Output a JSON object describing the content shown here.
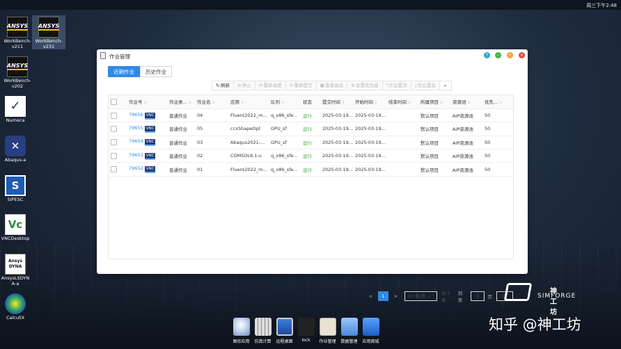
{
  "topbar": {
    "clock": "周三下午2:48"
  },
  "desktop_icons": [
    {
      "label_line1": "WorkBench-",
      "label_line2": "v211",
      "icon": "ansys-icon",
      "logo": "ANSYS"
    },
    {
      "label_line1": "WorkBench-",
      "label_line2": "v231",
      "icon": "ansys-icon",
      "logo": "ANSYS"
    },
    {
      "label_line1": "WorkBench-",
      "label_line2": "v202",
      "icon": "ansys-icon",
      "logo": "ANSYS"
    },
    {
      "label_line1": "Numeca",
      "label_line2": "",
      "icon": "numeca-icon"
    },
    {
      "label_line1": "Abaqus-a",
      "label_line2": "",
      "icon": "abaqus-icon"
    },
    {
      "label_line1": "SIPESC",
      "label_line2": "",
      "icon": "sipesc-icon"
    },
    {
      "label_line1": "VNCDesktop",
      "label_line2": "",
      "icon": "vnc-icon"
    },
    {
      "label_line1": "AnsysLSDYN",
      "label_line2": "A-a",
      "icon": "ls-dyna-icon",
      "logo_line1": "Ansys",
      "logo_line2": "DYNA"
    },
    {
      "label_line1": "CalculiX",
      "label_line2": "",
      "icon": "calculix-icon"
    }
  ],
  "window": {
    "title": "作业管理",
    "tabs": [
      {
        "label": "近期作业",
        "active": true
      },
      {
        "label": "历史作业",
        "active": false
      }
    ],
    "toolbar": [
      {
        "label": "刷新",
        "glyph": "↻",
        "enabled": true
      },
      {
        "label": "停止",
        "glyph": "⊘",
        "enabled": false
      },
      {
        "label": "重新调度",
        "glyph": "⟳",
        "enabled": false
      },
      {
        "label": "重新提交",
        "glyph": "⟳",
        "enabled": false
      },
      {
        "label": "查看输出",
        "glyph": "▣",
        "enabled": false
      },
      {
        "label": "设置优先级",
        "glyph": "⇅",
        "enabled": false
      },
      {
        "label": "作业置顶",
        "glyph": "⤒",
        "enabled": false
      },
      {
        "label": "作业置底",
        "glyph": "⤓",
        "enabled": false
      }
    ],
    "columns": [
      "作业号",
      "作业类...",
      "作业名",
      "应用",
      "队列",
      "状态",
      "提交时间",
      "开始时间",
      "结束时间",
      "所属项目",
      "资源池",
      "优先..."
    ],
    "rows": [
      {
        "id": "79656",
        "vnc": "VNC",
        "type": "普通作业",
        "name": "04",
        "app": "Fluent2022_m...",
        "queue": "q_x86_sfe...",
        "status": "运行",
        "submit": "2025-03-19...",
        "start": "2025-03-19...",
        "end": "",
        "project": "默认项目",
        "pool": "AIP资源池",
        "priority": "50"
      },
      {
        "id": "79655",
        "vnc": "VNC",
        "type": "普通作业",
        "name": "05",
        "app": "ccxShapeOpt",
        "queue": "GPU_sf",
        "status": "运行",
        "submit": "2025-03-19...",
        "start": "2025-03-19...",
        "end": "",
        "project": "默认项目",
        "pool": "AIP资源池",
        "priority": "50"
      },
      {
        "id": "79654",
        "vnc": "VNC",
        "type": "普通作业",
        "name": "03",
        "app": "Abaqus2021-...",
        "queue": "GPU_sf",
        "status": "运行",
        "submit": "2025-03-19...",
        "start": "2025-03-19...",
        "end": "",
        "project": "默认项目",
        "pool": "AIP资源池",
        "priority": "50"
      },
      {
        "id": "79653",
        "vnc": "VNC",
        "type": "普通作业",
        "name": "02",
        "app": "COMSOL6.1-u",
        "queue": "q_x86_sfe...",
        "status": "运行",
        "submit": "2025-03-19...",
        "start": "2025-03-19...",
        "end": "",
        "project": "默认项目",
        "pool": "AIP资源池",
        "priority": "50"
      },
      {
        "id": "79652",
        "vnc": "VNC",
        "type": "普通作业",
        "name": "01",
        "app": "Fluent2022_m...",
        "queue": "q_x86_sfe...",
        "status": "运行",
        "submit": "2025-03-19...",
        "start": "2025-03-19...",
        "end": "",
        "project": "默认项目",
        "pool": "AIP资源池",
        "priority": "50"
      }
    ],
    "pager": {
      "prev": "<",
      "current_page": "1",
      "next": ">",
      "page_size": "10 条/页",
      "total": "共 5 条",
      "goto_label": "到第",
      "goto_value": "1",
      "page_unit": "页",
      "confirm": "确定"
    }
  },
  "brand": {
    "cn": "神工坊",
    "en": "SIMFORGE"
  },
  "watermark": "知乎 @神工坊",
  "dock": [
    {
      "label": "图形应用",
      "icon": "graphics-app-icon"
    },
    {
      "label": "仿真计算",
      "icon": "calculator-icon"
    },
    {
      "label": "远程桌面",
      "icon": "remote-desktop-icon"
    },
    {
      "label": "lock",
      "icon": "lock-icon"
    },
    {
      "label": "作业管理",
      "icon": "job-manager-icon"
    },
    {
      "label": "数据管理",
      "icon": "data-manager-icon"
    },
    {
      "label": "应用商城",
      "icon": "app-store-icon"
    }
  ],
  "colors": {
    "accent": "#2e8ae6",
    "running": "#3caa3c",
    "vnc_badge": "#1f3e7a"
  }
}
